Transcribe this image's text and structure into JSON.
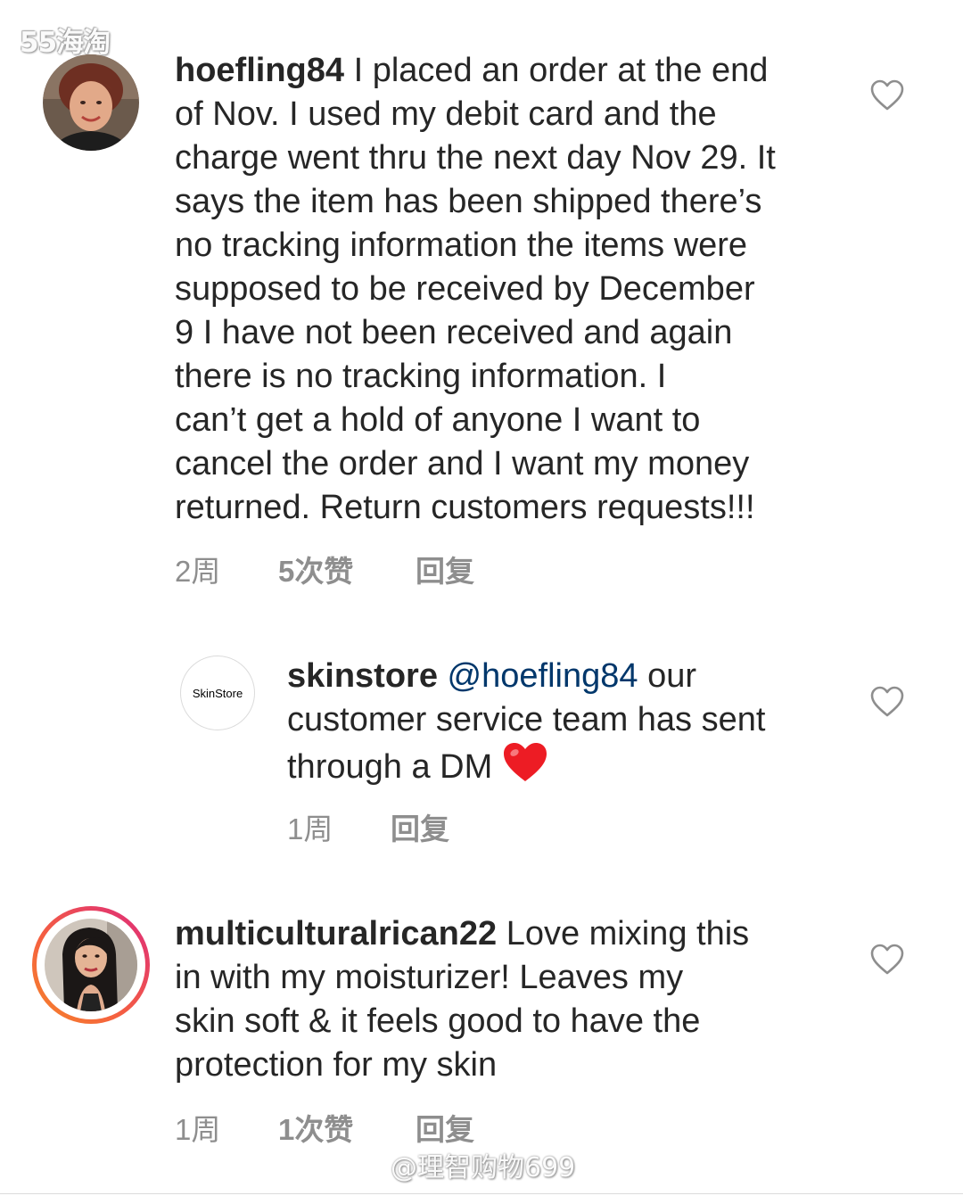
{
  "watermarks": {
    "top": "55海淘",
    "bottom": "@理智购物699"
  },
  "comments": [
    {
      "username": "hoefling84",
      "text": "I placed an order at the end of Nov. I used my debit card and the charge went thru the next day Nov 29. It says the item has been shipped there’s no tracking information the items were supposed to be received by December 9 I have not been received and again there is no tracking information. I can’t get a hold of anyone I want to cancel the order and I want my money returned. Return customers requests!!!",
      "time": "2周",
      "likes": "5次赞",
      "reply": "回复",
      "like_icon": "heart-outline-icon"
    },
    {
      "username": "skinstore",
      "mention": "@hoefling84",
      "text": "our customer service team has sent through a DM",
      "emoji": "❤️",
      "avatar_text": "SkinStore",
      "time": "1周",
      "reply": "回复",
      "like_icon": "heart-outline-icon"
    },
    {
      "username": "multiculturalrican22",
      "text": "Love mixing this in with my moisturizer! Leaves my skin soft & it feels good to have the protection for my skin",
      "time": "1周",
      "likes": "1次赞",
      "reply": "回复",
      "like_icon": "heart-outline-icon",
      "story_ring": true
    }
  ],
  "colors": {
    "text": "#262626",
    "meta": "#8e8e8e",
    "mention": "#00376b",
    "heart_emoji": "#ed1c24",
    "story_ring_start": "#f58529",
    "story_ring_end": "#dd2a7b"
  }
}
